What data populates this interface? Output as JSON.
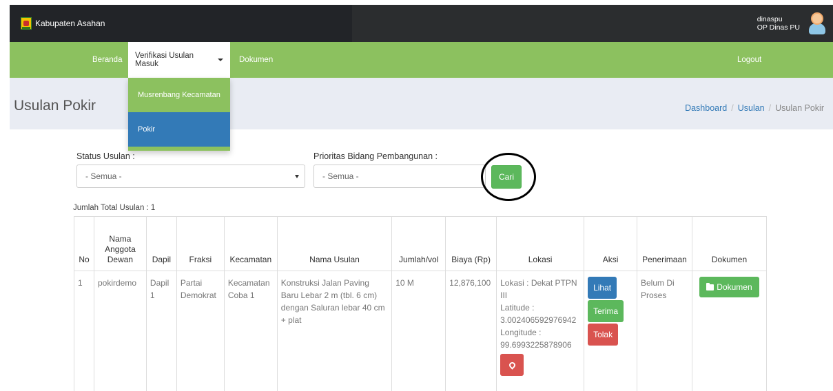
{
  "app": {
    "name": "Kabupaten Asahan"
  },
  "user": {
    "username": "dinaspu",
    "role": "OP Dinas PU"
  },
  "nav": {
    "items": [
      {
        "label": "Beranda"
      },
      {
        "label": "Verifikasi Usulan Masuk"
      },
      {
        "label": "Dokumen"
      }
    ],
    "logout": "Logout"
  },
  "dropdown": {
    "items": [
      {
        "label": "Musrenbang Kecamatan"
      },
      {
        "label": "Pokir"
      }
    ]
  },
  "page": {
    "title": "Usulan Pokir"
  },
  "breadcrumb": {
    "items": [
      "Dashboard",
      "Usulan",
      "Usulan Pokir"
    ]
  },
  "filters": {
    "status_label": "Status Usulan :",
    "status_value": "- Semua -",
    "prioritas_label": "Prioritas Bidang Pembangunan :",
    "prioritas_value": "- Semua -",
    "search_button": "Cari"
  },
  "summary": {
    "total": "Jumlah Total Usulan : 1"
  },
  "table": {
    "headers": [
      "No",
      "Nama Anggota Dewan",
      "Dapil",
      "Fraksi",
      "Kecamatan",
      "Nama Usulan",
      "Jumlah/vol",
      "Biaya (Rp)",
      "Lokasi",
      "Aksi",
      "Penerimaan",
      "Dokumen"
    ],
    "rows": [
      {
        "no": "1",
        "nama": "pokirdemo",
        "dapil": "Dapil 1",
        "fraksi": "Partai Demokrat",
        "kecamatan": "Kecamatan Coba 1",
        "nama_usulan": "Konstruksi Jalan Paving Baru Lebar 2 m (tbl. 6 cm) dengan Saluran lebar 40 cm + plat",
        "jumlah": "10 M",
        "biaya": "12,876,100",
        "lokasi": "Lokasi : Dekat PTPN III",
        "latitude": "Latitude : 3.002406592976942",
        "longitude": "Longitude : 99.6993225878906",
        "aksi": {
          "lihat": "Lihat",
          "terima": "Terima",
          "tolak": "Tolak"
        },
        "penerimaan": "Belum Di Proses",
        "dokumen": "Dokumen"
      }
    ]
  },
  "colors": {
    "nav_green": "#8cc15f",
    "topbar": "#2b2d2f",
    "primary": "#337ab7",
    "success": "#5cb85c",
    "danger": "#d9534f"
  },
  "icons": {
    "logo": "kabupaten-logo-icon",
    "avatar": "user-avatar-icon",
    "caret": "caret-down-icon",
    "folder": "folder-icon",
    "pin": "map-marker-icon"
  }
}
